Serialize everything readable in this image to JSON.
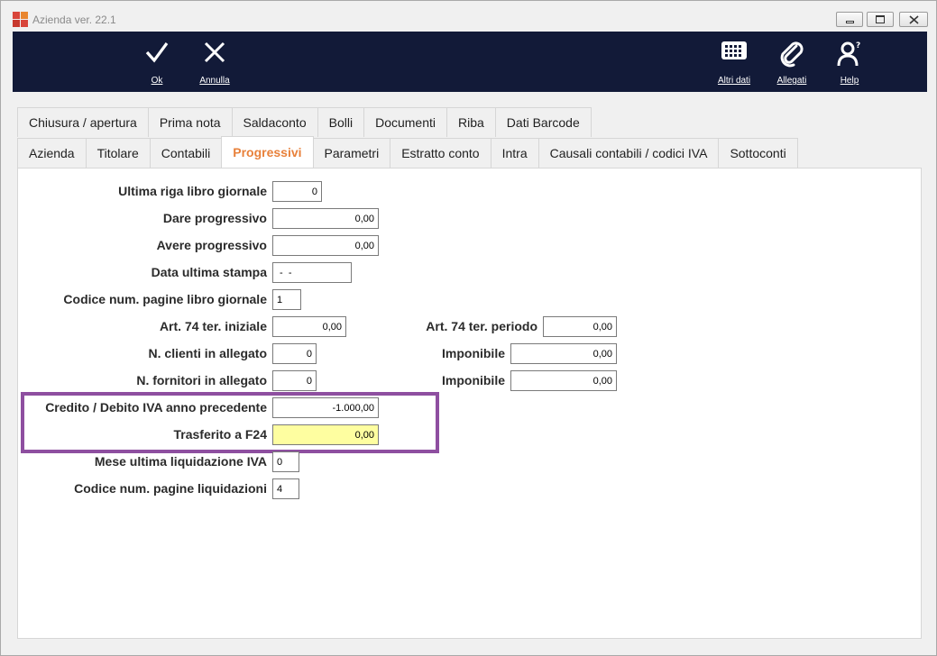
{
  "window": {
    "title": "Azienda ver. 22.1"
  },
  "toolbar": {
    "ok": {
      "label": "Ok",
      "icon": "check-icon"
    },
    "annulla": {
      "label": "Annulla",
      "icon": "x-icon"
    },
    "altri_dati": {
      "label": "Altri dati",
      "icon": "grid-icon"
    },
    "allegati": {
      "label": "Allegati",
      "icon": "paperclip-icon"
    },
    "help": {
      "label": "Help",
      "icon": "help-person-icon"
    }
  },
  "tabs_row1": [
    "Chiusura / apertura",
    "Prima nota",
    "Saldaconto",
    "Bolli",
    "Documenti",
    "Riba",
    "Dati Barcode"
  ],
  "tabs_row2": [
    "Azienda",
    "Titolare",
    "Contabili",
    "Progressivi",
    "Parametri",
    "Estratto conto",
    "Intra",
    "Causali contabili / codici IVA",
    "Sottoconti"
  ],
  "active_tab": "Progressivi",
  "form": {
    "ultima_riga": {
      "label": "Ultima riga libro giornale",
      "value": "0"
    },
    "dare_progressivo": {
      "label": "Dare progressivo",
      "value": "0,00"
    },
    "avere_progressivo": {
      "label": "Avere progressivo",
      "value": "0,00"
    },
    "data_ultima_stampa": {
      "label": "Data ultima stampa",
      "value": " -  -"
    },
    "codice_pagine_giornale": {
      "label": "Codice num. pagine libro giornale",
      "value": "1"
    },
    "art74_iniziale": {
      "label": "Art. 74 ter. iniziale",
      "value": "0,00"
    },
    "art74_periodo": {
      "label": "Art. 74 ter. periodo",
      "value": "0,00"
    },
    "n_clienti": {
      "label": "N. clienti in allegato",
      "value": "0"
    },
    "imponibile_clienti": {
      "label": "Imponibile",
      "value": "0,00"
    },
    "n_fornitori": {
      "label": "N. fornitori in allegato",
      "value": "0"
    },
    "imponibile_fornitori": {
      "label": "Imponibile",
      "value": "0,00"
    },
    "credito_debito_iva": {
      "label": "Credito / Debito IVA anno precedente",
      "value": "-1.000,00"
    },
    "trasferito_f24": {
      "label": "Trasferito a F24",
      "value": "0,00"
    },
    "mese_ultima_liquidazione": {
      "label": "Mese ultima liquidazione IVA",
      "value": "0"
    },
    "codice_pagine_liquidazioni": {
      "label": "Codice num. pagine liquidazioni",
      "value": "4"
    }
  },
  "colors": {
    "toolbar_bg": "#121a38",
    "active_tab": "#e8813b",
    "highlight_border": "#8e4fa0",
    "highlight_field": "#fefea0"
  }
}
